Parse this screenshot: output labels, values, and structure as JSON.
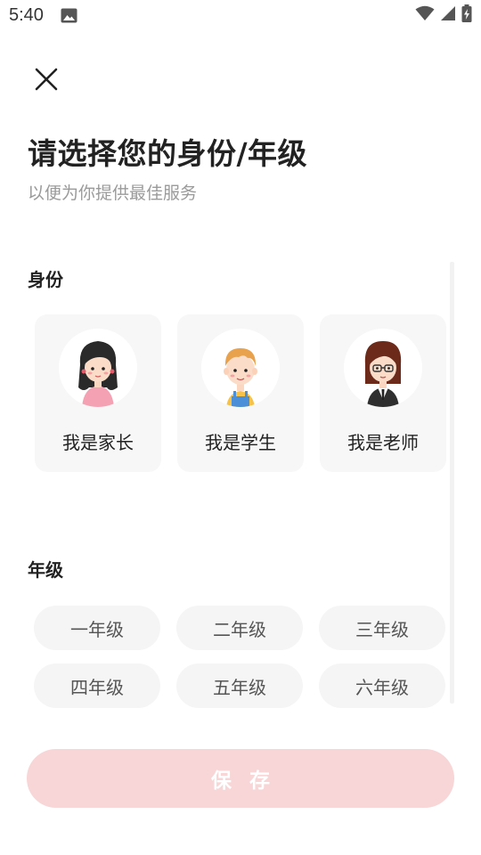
{
  "status_bar": {
    "time": "5:40",
    "icons": [
      "gallery-icon",
      "wifi-icon",
      "signal-icon",
      "battery-charging-icon"
    ]
  },
  "header": {
    "close_icon": "close-icon",
    "title": "请选择您的身份/年级",
    "subtitle": "以便为你提供最佳服务"
  },
  "identity": {
    "label": "身份",
    "options": [
      {
        "label": "我是家长",
        "icon": "parent-avatar-icon"
      },
      {
        "label": "我是学生",
        "icon": "student-avatar-icon"
      },
      {
        "label": "我是老师",
        "icon": "teacher-avatar-icon"
      }
    ]
  },
  "grade": {
    "label": "年级",
    "options": [
      "一年级",
      "二年级",
      "三年级",
      "四年级",
      "五年级",
      "六年级"
    ]
  },
  "save_button": {
    "label": "保存",
    "color": "#f8d5d6"
  }
}
